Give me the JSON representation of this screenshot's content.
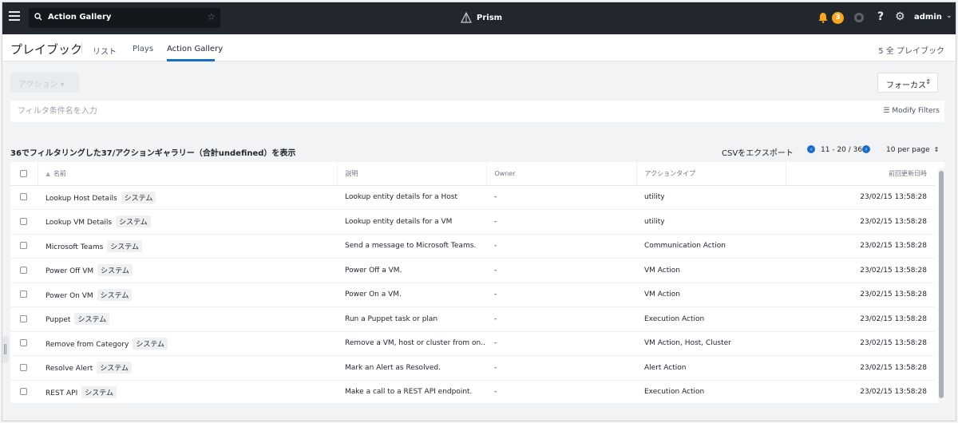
{
  "topbar": {
    "search_value": "Action Gallery",
    "brand": "Prism",
    "notification_count": "3",
    "user": "admin"
  },
  "page": {
    "title": "プレイブック",
    "tabs": [
      {
        "label": "リスト"
      },
      {
        "label": "Plays"
      },
      {
        "label": "Action Gallery"
      }
    ],
    "count_label": "5 全 プレイブック"
  },
  "toolbar": {
    "action_label": "アクション ▾",
    "focus_label": "フォーカス",
    "filter_placeholder": "フィルタ条件名を入力",
    "modify_filters": "Modify Filters"
  },
  "summary": {
    "text": "36でフィルタリングした37/アクションギャラリー（合計undefined）を表示",
    "csv_export": "CSVをエクスポート",
    "page_range": "11 - 20 / 36",
    "per_page": "10 per page"
  },
  "table": {
    "columns": [
      "名前",
      "説明",
      "Owner",
      "アクションタイプ",
      "前回更新日時"
    ],
    "system_tag": "システム",
    "rows": [
      {
        "name": "Lookup Host Details",
        "desc": "Lookup entity details for a Host",
        "owner": "-",
        "type": "utility",
        "updated": "23/02/15 13:58:28"
      },
      {
        "name": "Lookup VM Details",
        "desc": "Lookup entity details for a VM",
        "owner": "-",
        "type": "utility",
        "updated": "23/02/15 13:58:28"
      },
      {
        "name": "Microsoft Teams",
        "desc": "Send a message to Microsoft Teams.",
        "owner": "-",
        "type": "Communication Action",
        "updated": "23/02/15 13:58:28"
      },
      {
        "name": "Power Off VM",
        "desc": "Power Off a VM.",
        "owner": "-",
        "type": "VM Action",
        "updated": "23/02/15 13:58:28"
      },
      {
        "name": "Power On VM",
        "desc": "Power On a VM.",
        "owner": "-",
        "type": "VM Action",
        "updated": "23/02/15 13:58:28"
      },
      {
        "name": "Puppet",
        "desc": "Run a Puppet task or plan",
        "owner": "-",
        "type": "Execution Action",
        "updated": "23/02/15 13:58:28"
      },
      {
        "name": "Remove from Category",
        "desc": "Remove a VM, host or cluster from on...",
        "owner": "-",
        "type": "VM Action, Host, Cluster",
        "updated": "23/02/15 13:58:28"
      },
      {
        "name": "Resolve Alert",
        "desc": "Mark an Alert as Resolved.",
        "owner": "-",
        "type": "Alert Action",
        "updated": "23/02/15 13:58:28"
      },
      {
        "name": "REST API",
        "desc": "Make a call to a REST API endpoint.",
        "owner": "-",
        "type": "Execution Action",
        "updated": "23/02/15 13:58:28"
      }
    ]
  },
  "colors": {
    "topbar": "#22272e",
    "accent": "#1b6dc6",
    "badge": "#f5a623"
  }
}
